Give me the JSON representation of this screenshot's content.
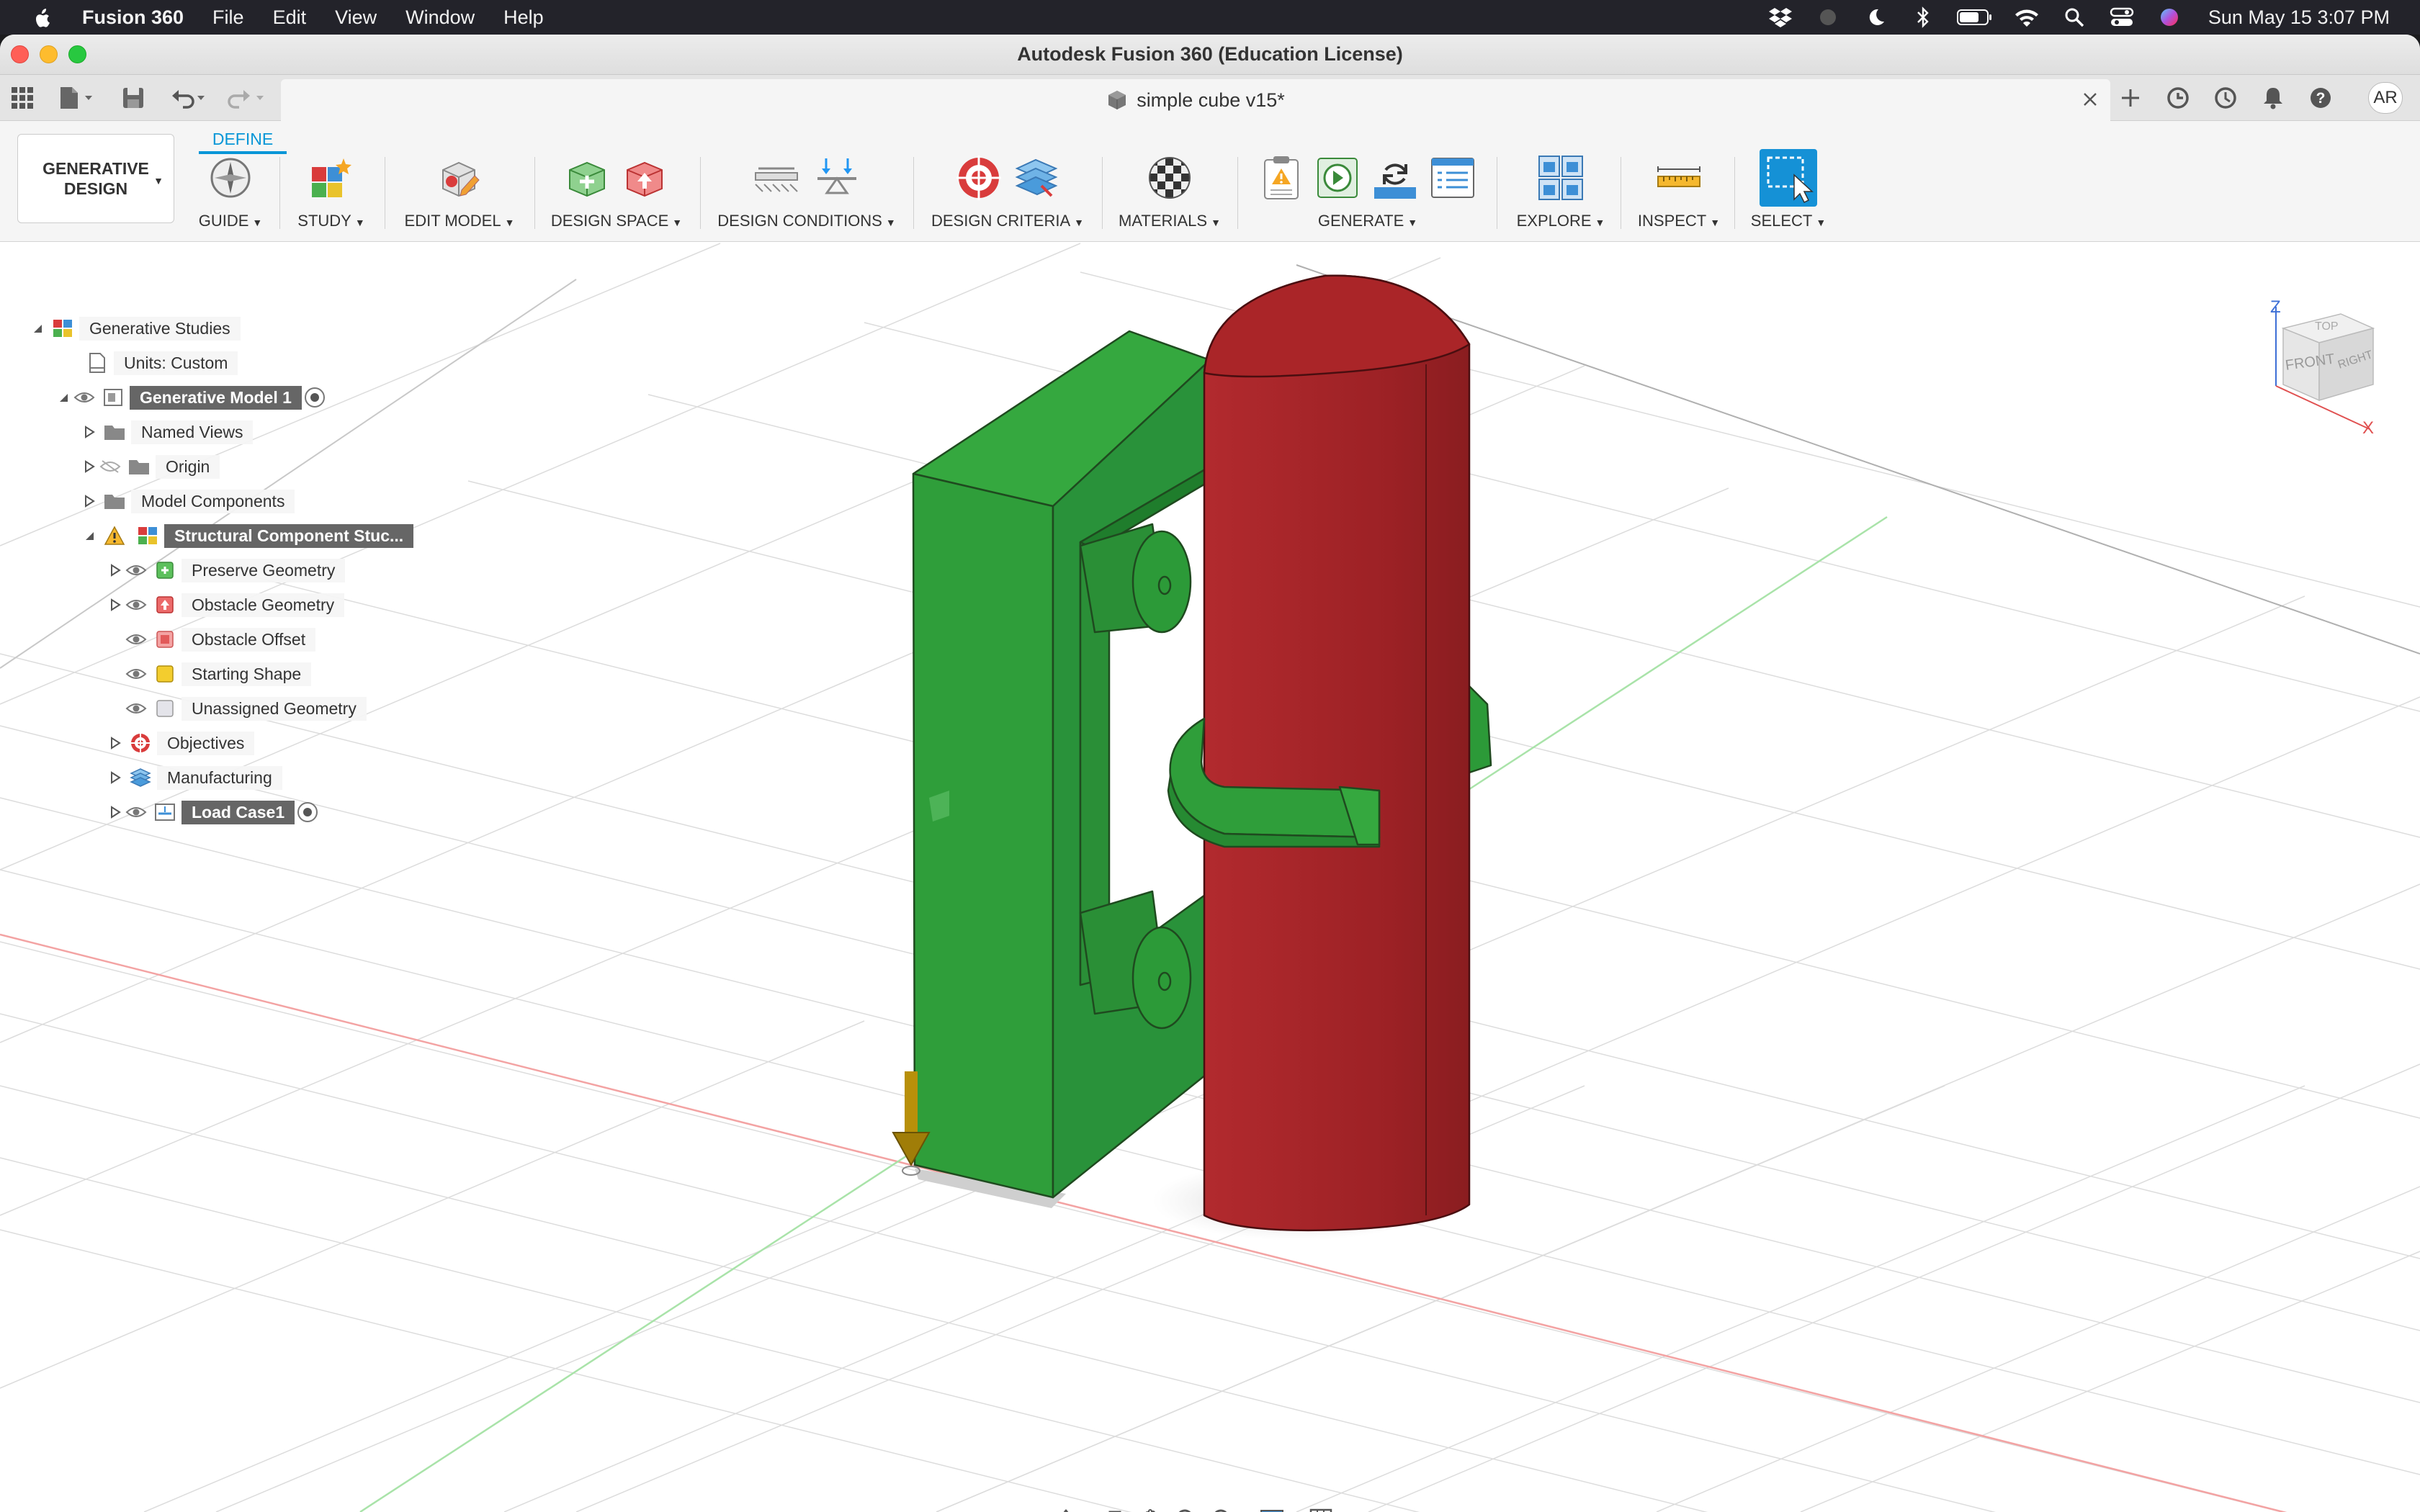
{
  "menubar": {
    "app_name": "Fusion 360",
    "items": [
      "File",
      "Edit",
      "View",
      "Window",
      "Help"
    ],
    "clock": "Sun May 15  3:07 PM"
  },
  "window": {
    "title": "Autodesk Fusion 360 (Education License)"
  },
  "document": {
    "tab_title": "simple cube v15*",
    "user_initials": "AR"
  },
  "toolbar": {
    "workspace": "GENERATIVE DESIGN",
    "active_tab": "DEFINE",
    "groups": {
      "guide": "GUIDE",
      "study": "STUDY",
      "edit_model": "EDIT MODEL",
      "design_space": "DESIGN SPACE",
      "design_conditions": "DESIGN CONDITIONS",
      "design_criteria": "DESIGN CRITERIA",
      "materials": "MATERIALS",
      "generate": "GENERATE",
      "explore": "EXPLORE",
      "inspect": "INSPECT",
      "select": "SELECT"
    }
  },
  "browser": {
    "root": "Generative Studies",
    "units": "Units: Custom",
    "model": "Generative Model 1",
    "named_views": "Named Views",
    "origin": "Origin",
    "model_components": "Model Components",
    "study": "Structural Component Stuc...",
    "preserve": "Preserve Geometry",
    "obstacle": "Obstacle Geometry",
    "obstacle_offset": "Obstacle Offset",
    "starting_shape": "Starting Shape",
    "unassigned": "Unassigned Geometry",
    "objectives": "Objectives",
    "manufacturing": "Manufacturing",
    "load_case": "Load Case1"
  },
  "viewcube": {
    "top": "TOP",
    "front": "FRONT",
    "right": "RIGHT",
    "z_axis": "Z",
    "x_axis": "X"
  },
  "colors": {
    "preserve_green": "#2f9e3a",
    "obstacle_red": "#a52428",
    "accent_blue": "#0696d7",
    "load_arrow": "#b8900a"
  }
}
